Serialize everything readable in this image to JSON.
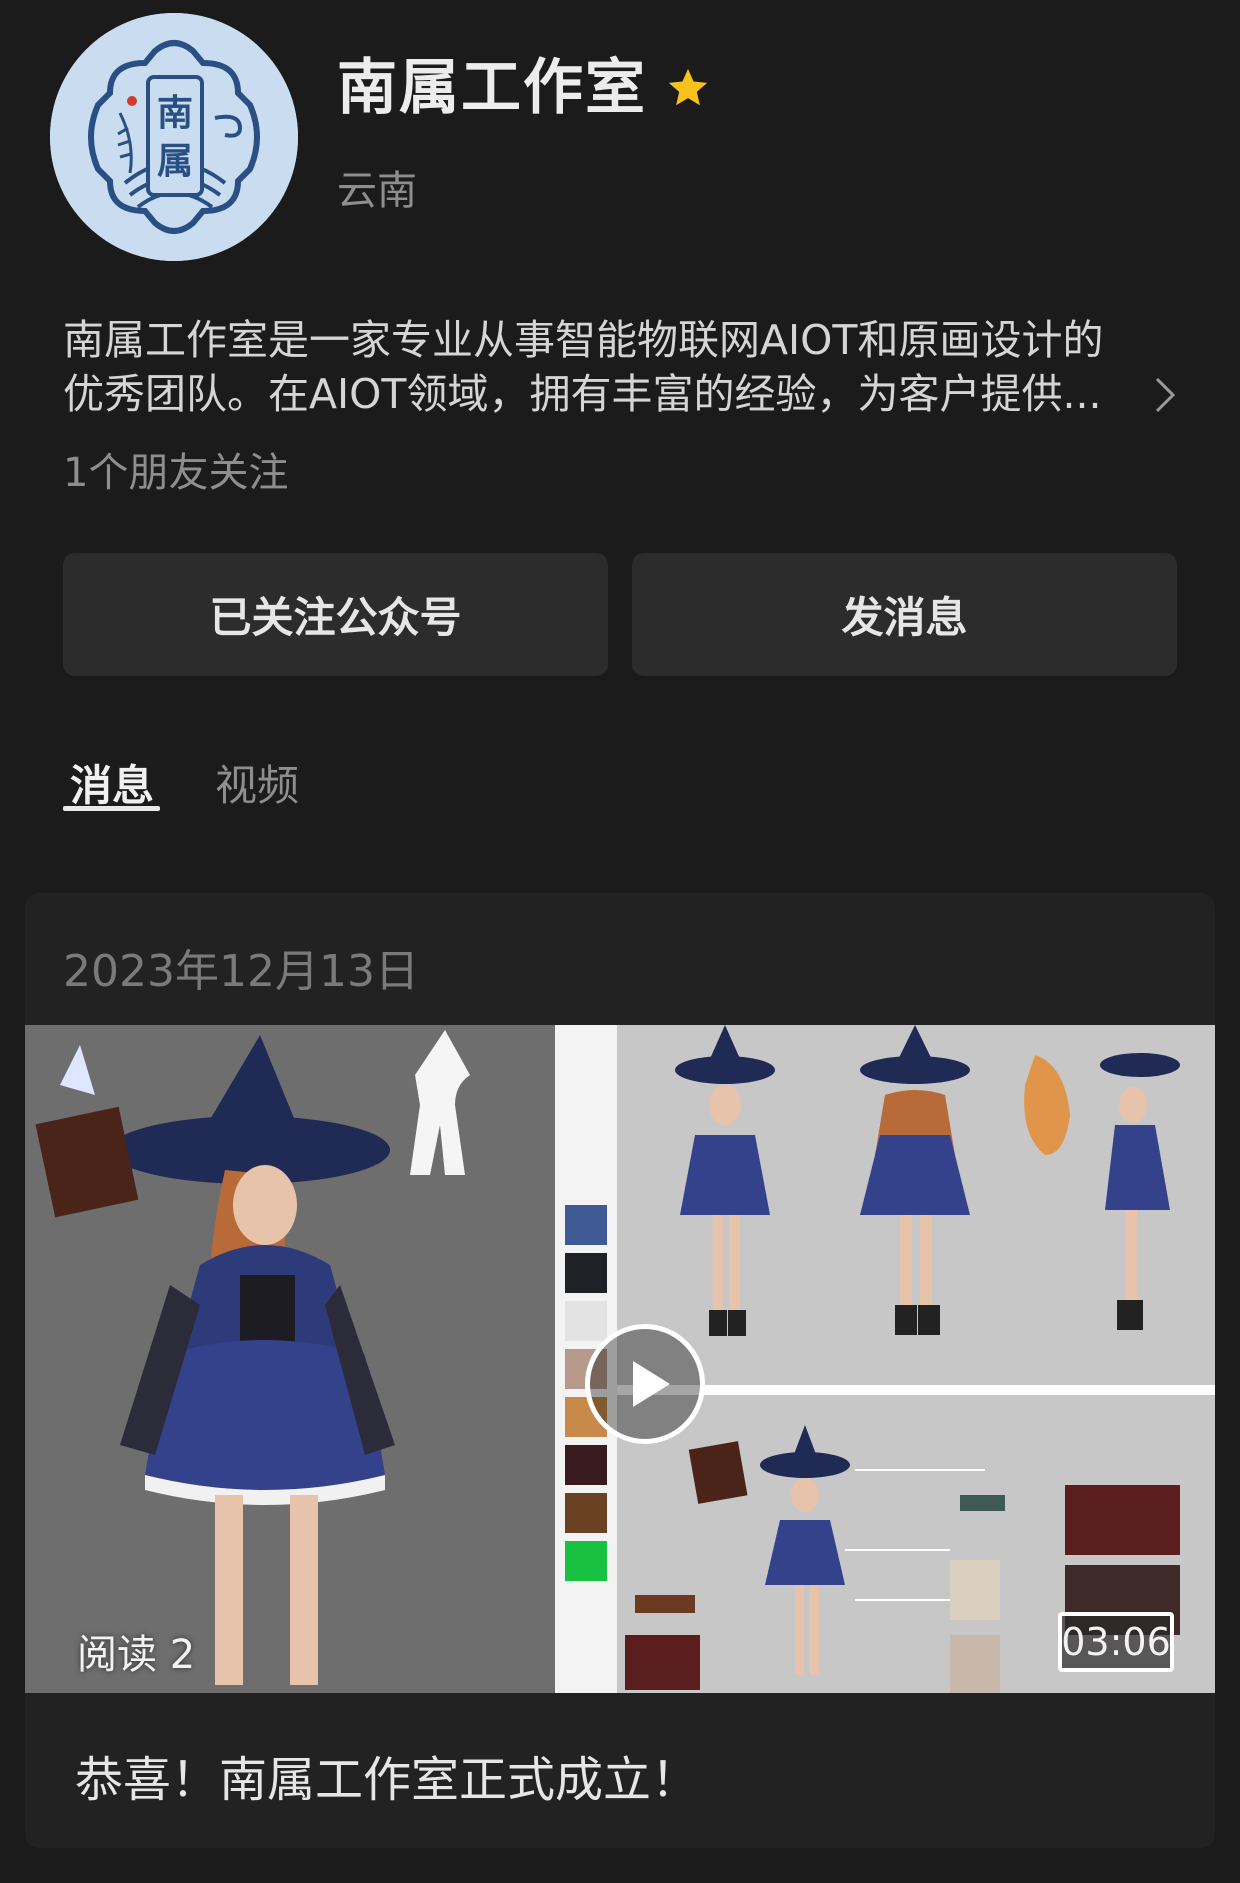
{
  "account": {
    "name": "南属工作室",
    "location": "云南",
    "logo_text_top": "南",
    "logo_text_bottom": "属",
    "description_line1": "南属工作室是一家专业从事智能物联网AIOT和原画设计的",
    "description_line2": "优秀团队。在AIOT领域，拥有丰富的经验，为客户提供...",
    "friends_following": "1个朋友关注"
  },
  "actions": {
    "follow_label": "已关注公众号",
    "message_label": "发消息"
  },
  "tabs": [
    {
      "label": "消息",
      "active": true
    },
    {
      "label": "视频",
      "active": false
    }
  ],
  "post": {
    "date": "2023年12月13日",
    "reads": "阅读 2",
    "duration": "03:06",
    "title": "恭喜！南属工作室正式成立！"
  },
  "icons": {
    "badge": "star-icon",
    "more": "chevron-right-icon",
    "play": "play-icon"
  },
  "colors": {
    "background": "#1b1b1b",
    "star": "#f7c21b",
    "button": "#2c2c2c",
    "logo_blue": "#2a4f84"
  }
}
